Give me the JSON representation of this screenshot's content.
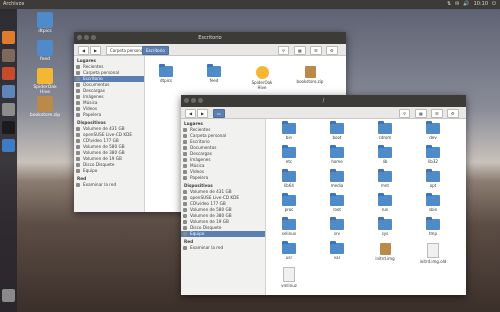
{
  "topbar": {
    "app_name": "Archivos",
    "clock": "10:10"
  },
  "desktop": [
    {
      "label": "dtpics",
      "kind": "folder"
    },
    {
      "label": "feed",
      "kind": "folder"
    },
    {
      "label": "SpiderOak Hive",
      "kind": "spin"
    },
    {
      "label": "bookstore.zip",
      "kind": "archive"
    }
  ],
  "window1": {
    "title": "Escritorio",
    "toolbar": {
      "crumb1": "Carpeta personal",
      "crumb2": "Escritorio"
    },
    "sidebar": {
      "sections": [
        {
          "header": "Lugares",
          "items": [
            "Recientes",
            "Carpeta personal",
            "Escritorio",
            "Documentos",
            "Descargas",
            "Imágenes",
            "Música",
            "Vídeos",
            "Papelera"
          ]
        },
        {
          "header": "Dispositivos",
          "items": [
            "Volumen de 431 GB",
            "openSUSE Live-CD KDE",
            "CD\\video 177 GB",
            "Volumen de 580 GB",
            "Volumen de 380 GB",
            "Volumen de 19 GB",
            "Disco Disquete",
            "Equipo"
          ]
        },
        {
          "header": "Red",
          "items": [
            "Examinar la red"
          ]
        }
      ],
      "selected": "Escritorio"
    },
    "files": [
      {
        "name": "dtpics",
        "kind": "folder"
      },
      {
        "name": "feed",
        "kind": "folder"
      },
      {
        "name": "SpiderOak Hive",
        "kind": "spin"
      },
      {
        "name": "bookstore.zip",
        "kind": "archive"
      }
    ]
  },
  "window2": {
    "title": "/",
    "sidebar": {
      "sections": [
        {
          "header": "Lugares",
          "items": [
            "Recientes",
            "Carpeta personal",
            "Escritorio",
            "Documentos",
            "Descargas",
            "Imágenes",
            "Música",
            "Vídeos",
            "Papelera"
          ]
        },
        {
          "header": "Dispositivos",
          "items": [
            "Volumen de 431 GB",
            "openSUSE Live-CD KDE",
            "CD\\video 177 GB",
            "Volumen de 580 GB",
            "Volumen de 380 GB",
            "Volumen de 19 GB",
            "Disco Disquete",
            "Equipo"
          ]
        },
        {
          "header": "Red",
          "items": [
            "Examinar la red"
          ]
        }
      ],
      "selected": "Equipo"
    },
    "files": [
      {
        "name": "bin",
        "kind": "folder"
      },
      {
        "name": "boot",
        "kind": "folder"
      },
      {
        "name": "cdrom",
        "kind": "folder"
      },
      {
        "name": "dev",
        "kind": "folder"
      },
      {
        "name": "etc",
        "kind": "folder"
      },
      {
        "name": "home",
        "kind": "folder"
      },
      {
        "name": "lib",
        "kind": "folder"
      },
      {
        "name": "lib32",
        "kind": "folder"
      },
      {
        "name": "lib64",
        "kind": "folder"
      },
      {
        "name": "media",
        "kind": "folder"
      },
      {
        "name": "mnt",
        "kind": "folder"
      },
      {
        "name": "opt",
        "kind": "folder"
      },
      {
        "name": "proc",
        "kind": "folder"
      },
      {
        "name": "root",
        "kind": "folder"
      },
      {
        "name": "run",
        "kind": "folder"
      },
      {
        "name": "sbin",
        "kind": "folder"
      },
      {
        "name": "selinux",
        "kind": "folder"
      },
      {
        "name": "srv",
        "kind": "folder"
      },
      {
        "name": "sys",
        "kind": "folder"
      },
      {
        "name": "tmp",
        "kind": "folder"
      },
      {
        "name": "usr",
        "kind": "folder"
      },
      {
        "name": "var",
        "kind": "folder"
      },
      {
        "name": "initrd.img",
        "kind": "archive"
      },
      {
        "name": "initrd.img.old",
        "kind": "doc"
      },
      {
        "name": "vmlinuz",
        "kind": "doc"
      }
    ]
  },
  "launcher_items": [
    "dash-icon",
    "firefox-icon",
    "files-icon",
    "software-icon",
    "office-icon",
    "settings-icon",
    "terminal-icon",
    "update-icon",
    "trash-icon"
  ]
}
